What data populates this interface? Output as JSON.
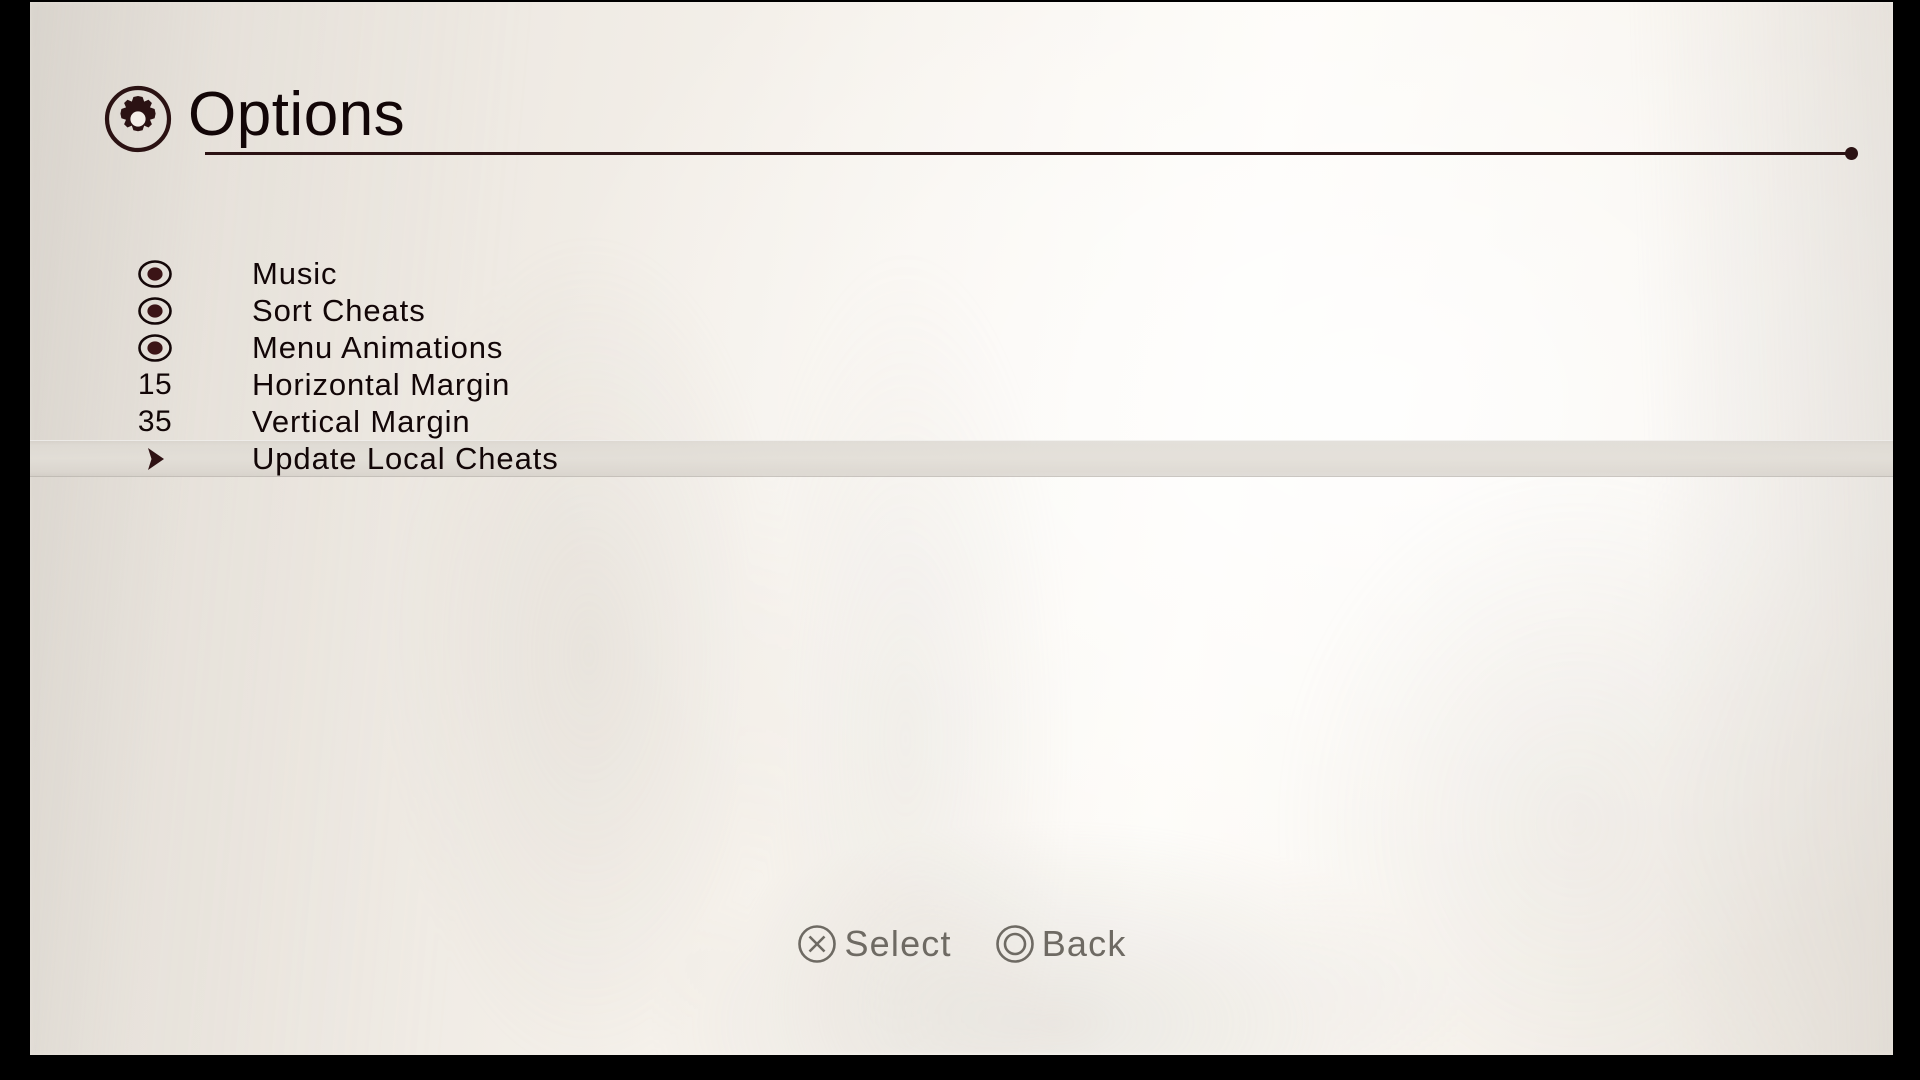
{
  "header": {
    "title": "Options",
    "icon": "gear-icon"
  },
  "theme": {
    "text_color": "#120607",
    "rule_color": "#2b1213",
    "hint_color": "#6e6a63",
    "highlight_color": "#e2ded7",
    "background_color": "#f6f2ec",
    "letterbox_color": "#000000"
  },
  "menu": {
    "selected_index": 5,
    "items": [
      {
        "value": "on",
        "value_type": "toggle",
        "label": "Music",
        "selected": false
      },
      {
        "value": "on",
        "value_type": "toggle",
        "label": "Sort Cheats",
        "selected": false
      },
      {
        "value": "on",
        "value_type": "toggle",
        "label": "Menu Animations",
        "selected": false
      },
      {
        "value": "15",
        "value_type": "number",
        "label": "Horizontal Margin",
        "selected": false
      },
      {
        "value": "35",
        "value_type": "number",
        "label": "Vertical Margin",
        "selected": false
      },
      {
        "value": "",
        "value_type": "action",
        "label": "Update Local Cheats",
        "selected": true
      }
    ]
  },
  "footer": {
    "hints": [
      {
        "glyph": "cross-button-icon",
        "label": "Select"
      },
      {
        "glyph": "circle-button-icon",
        "label": "Back"
      }
    ]
  }
}
